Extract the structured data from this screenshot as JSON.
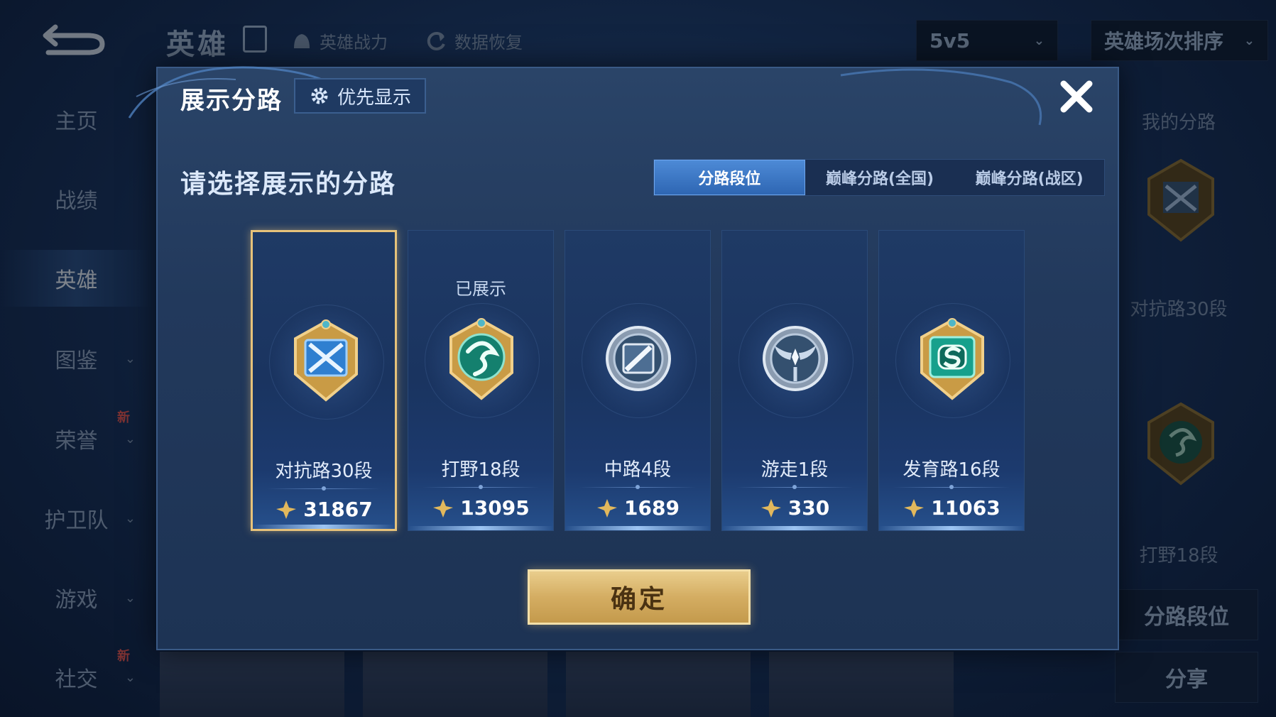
{
  "background": {
    "header": {
      "title": "英雄",
      "links": [
        {
          "label": "英雄战力",
          "icon": "helmet-icon"
        },
        {
          "label": "数据恢复",
          "icon": "restore-icon"
        }
      ],
      "mode_dropdown": "5v5",
      "sort_dropdown": "英雄场次排序"
    },
    "sidebar": {
      "items": [
        {
          "label": "主页"
        },
        {
          "label": "战绩"
        },
        {
          "label": "英雄"
        },
        {
          "label": "图鉴"
        },
        {
          "label": "荣誉",
          "badge": "新"
        },
        {
          "label": "护卫队"
        },
        {
          "label": "游戏"
        },
        {
          "label": "社交",
          "badge": "新"
        }
      ],
      "active": "英雄"
    },
    "right_panel": {
      "title": "我的分路",
      "lane1": "对抗路30段",
      "lane2": "打野18段",
      "button1": "分路段位",
      "button2": "分享"
    }
  },
  "modal": {
    "title": "展示分路",
    "priority_button": "优先显示",
    "subtitle": "请选择展示的分路",
    "tabs": [
      {
        "label": "分路段位",
        "active": true
      },
      {
        "label": "巅峰分路(全国)",
        "active": false
      },
      {
        "label": "巅峰分路(战区)",
        "active": false
      }
    ],
    "cards": [
      {
        "name": "对抗路30段",
        "points": "31867",
        "shown": "",
        "selected": true,
        "emblem": "clash-lane-emblem-icon"
      },
      {
        "name": "打野18段",
        "points": "13095",
        "shown": "已展示",
        "selected": false,
        "emblem": "jungle-dragon-emblem-icon"
      },
      {
        "name": "中路4段",
        "points": "1689",
        "shown": "",
        "selected": false,
        "emblem": "mid-lane-emblem-icon"
      },
      {
        "name": "游走1段",
        "points": "330",
        "shown": "",
        "selected": false,
        "emblem": "roam-wings-emblem-icon"
      },
      {
        "name": "发育路16段",
        "points": "11063",
        "shown": "",
        "selected": false,
        "emblem": "farm-lane-emblem-icon"
      }
    ],
    "confirm": "确定"
  },
  "colors": {
    "accent_gold": "#e6c27a",
    "tab_active": "#3f7bcc",
    "modal_bg": "#22395c"
  }
}
